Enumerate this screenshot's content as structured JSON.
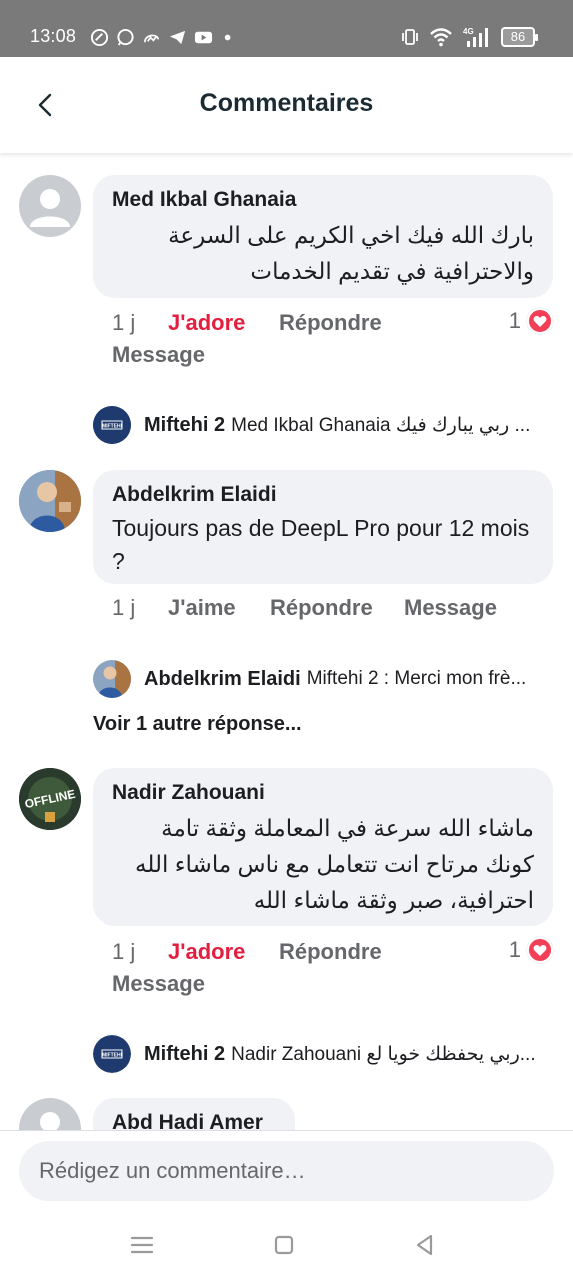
{
  "status_bar": {
    "time": "13:08",
    "battery": "86",
    "left_icons": [
      "vpn-key-icon",
      "whatsapp-icon",
      "messenger-icon",
      "telegram-icon",
      "youtube-icon",
      "dot-icon"
    ],
    "right_icons": [
      "vibrate-icon",
      "wifi-icon",
      "signal-4g-icon",
      "battery-icon"
    ]
  },
  "header": {
    "title": "Commentaires",
    "back_icon": "chevron-left-icon"
  },
  "comments": [
    {
      "author": "Med Ikbal Ghanaia",
      "text": "بارك الله فيك اخي الكريم على السرعة والاحترافية في تقديم الخدمات",
      "time": "1 j",
      "reaction_label": "J'adore",
      "reply_label": "Répondre",
      "message_label": "Message",
      "reaction_count": "1",
      "reply": {
        "author": "Miftehi 2",
        "text": "Med Ikbal Ghanaia ربي يبارك فيك ..."
      }
    },
    {
      "author": "Abdelkrim Elaidi",
      "text": "Toujours pas de DeepL Pro pour 12 mois ?",
      "time": "1 j",
      "reaction_label": "J'aime",
      "reply_label": "Répondre",
      "message_label": "Message",
      "reply": {
        "author": "Abdelkrim Elaidi",
        "text": "Miftehi 2 : Merci mon frè..."
      },
      "more_replies": "Voir 1 autre réponse..."
    },
    {
      "author": "Nadir Zahouani",
      "text": "ماشاء الله سرعة في المعاملة وثقة تامة كونك مرتاح انت تتعامل مع ناس ماشاء الله احترافية، صبر وثقة ماشاء الله",
      "time": "1 j",
      "reaction_label": "J'adore",
      "reply_label": "Répondre",
      "message_label": "Message",
      "reaction_count": "1",
      "reply": {
        "author": "Miftehi 2",
        "text": "Nadir Zahouani ربي يحفظك خويا لع..."
      }
    },
    {
      "author": "Abd Hadi Amer"
    }
  ],
  "composer": {
    "placeholder": "Rédigez un commentaire…"
  },
  "colors": {
    "love": "#e41e3f",
    "bubble": "#f0f2f5",
    "secondary_text": "#65676b",
    "status_bar": "#7a7a7a"
  }
}
